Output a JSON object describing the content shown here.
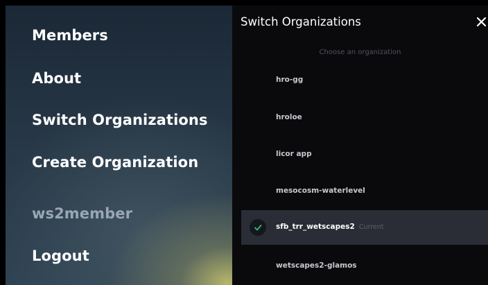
{
  "menu": {
    "items": [
      {
        "label": "Members"
      },
      {
        "label": "About"
      },
      {
        "label": "Switch Organizations"
      },
      {
        "label": "Create Organization"
      }
    ],
    "username": "ws2member",
    "logout_label": "Logout"
  },
  "panel": {
    "title": "Switch Organizations",
    "close_icon": "close-icon",
    "subtitle": "Choose an organization",
    "organizations": [
      {
        "name": "hro-gg",
        "current": false
      },
      {
        "name": "hroloe",
        "current": false
      },
      {
        "name": "licor app",
        "current": false
      },
      {
        "name": "mesocosm-waterlevel",
        "current": false
      },
      {
        "name": "sfb_trr_wetscapes2",
        "current": true,
        "current_label": "Current",
        "icon": "check-icon"
      },
      {
        "name": "wetscapes2-glamos",
        "current": false
      }
    ]
  },
  "colors": {
    "panel_background": "#0a0a0d",
    "active_row": "#2a2d36",
    "check_color": "#2fbf71"
  }
}
